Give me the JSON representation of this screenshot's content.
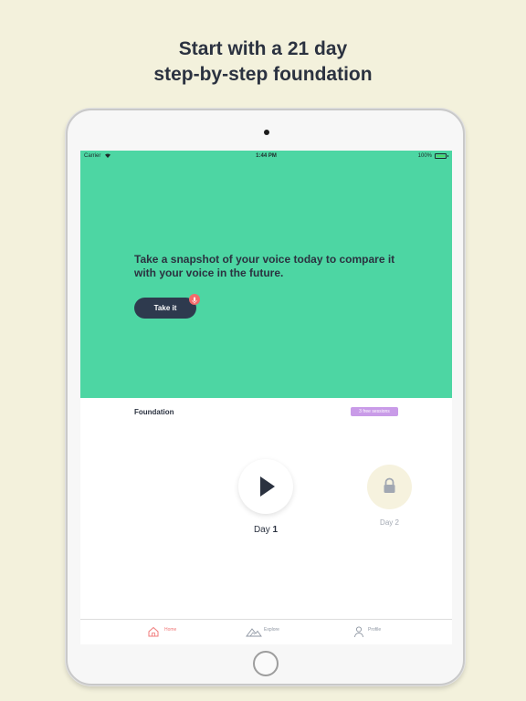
{
  "headline": {
    "line1": "Start with a 21 day",
    "line2": "step-by-step foundation"
  },
  "status_bar": {
    "carrier": "Carrier",
    "time": "1:44 PM",
    "battery": "100%"
  },
  "hero": {
    "text": "Take a snapshot of your voice today to compare it with your voice in the future.",
    "button_label": "Take it"
  },
  "foundation": {
    "title": "Foundation",
    "badge": "3 free sessions"
  },
  "days": [
    {
      "prefix": "Day ",
      "number": "1",
      "state": "play"
    },
    {
      "prefix": "Day ",
      "number": "2",
      "state": "locked"
    }
  ],
  "tabbar": {
    "items": [
      {
        "label": "Home",
        "icon": "home-icon",
        "active": true
      },
      {
        "label": "Explore",
        "icon": "mountain-icon",
        "active": false
      },
      {
        "label": "Profile",
        "icon": "person-icon",
        "active": false
      }
    ]
  },
  "colors": {
    "background": "#f3f1dc",
    "hero_green": "#4dd6a3",
    "dark_navy": "#2e3a4e",
    "accent_red": "#f26a6a",
    "badge_purple": "#c99be8",
    "lock_bg": "#f6f2de"
  }
}
